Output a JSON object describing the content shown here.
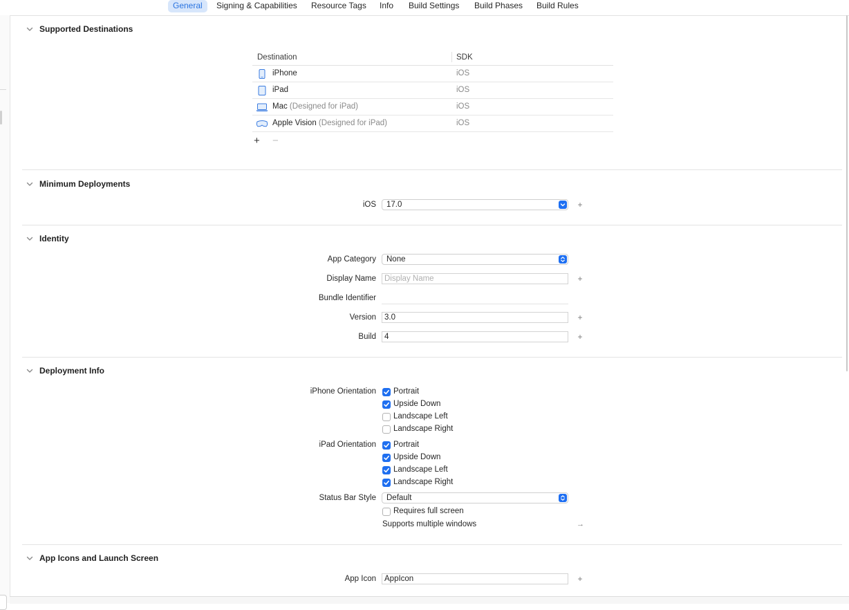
{
  "tabs": [
    {
      "label": "General",
      "active": true
    },
    {
      "label": "Signing & Capabilities"
    },
    {
      "label": "Resource Tags"
    },
    {
      "label": "Info"
    },
    {
      "label": "Build Settings"
    },
    {
      "label": "Build Phases"
    },
    {
      "label": "Build Rules"
    }
  ],
  "colors": {
    "accent": "#1f6ff0",
    "tab_active_bg": "#d7e6fb",
    "tab_active_text": "#2a74e0"
  },
  "supported_destinations": {
    "title": "Supported Destinations",
    "columns": [
      "Destination",
      "SDK"
    ],
    "rows": [
      {
        "icon": "iphone-icon",
        "name": "iPhone",
        "note": "",
        "sdk": "iOS"
      },
      {
        "icon": "ipad-icon",
        "name": "iPad",
        "note": "",
        "sdk": "iOS"
      },
      {
        "icon": "mac-laptop-icon",
        "name": "Mac",
        "note": " (Designed for iPad)",
        "sdk": "iOS"
      },
      {
        "icon": "vision-headset-icon",
        "name": "Apple Vision",
        "note": " (Designed for iPad)",
        "sdk": "iOS"
      }
    ],
    "add_label": "+",
    "remove_label": "−"
  },
  "minimum_deployments": {
    "title": "Minimum Deployments",
    "ios_label": "iOS",
    "ios_value": "17.0"
  },
  "identity": {
    "title": "Identity",
    "app_category_label": "App Category",
    "app_category_value": "None",
    "display_name_label": "Display Name",
    "display_name_placeholder": "Display Name",
    "bundle_identifier_label": "Bundle Identifier",
    "bundle_identifier_value": "",
    "version_label": "Version",
    "version_value": "3.0",
    "build_label": "Build",
    "build_value": "4"
  },
  "deployment_info": {
    "title": "Deployment Info",
    "iphone_orientation_label": "iPhone Orientation",
    "iphone_orientations": [
      {
        "label": "Portrait",
        "checked": true
      },
      {
        "label": "Upside Down",
        "checked": true
      },
      {
        "label": "Landscape Left",
        "checked": false
      },
      {
        "label": "Landscape Right",
        "checked": false
      }
    ],
    "ipad_orientation_label": "iPad Orientation",
    "ipad_orientations": [
      {
        "label": "Portrait",
        "checked": true
      },
      {
        "label": "Upside Down",
        "checked": true
      },
      {
        "label": "Landscape Left",
        "checked": true
      },
      {
        "label": "Landscape Right",
        "checked": true
      }
    ],
    "status_bar_style_label": "Status Bar Style",
    "status_bar_style_value": "Default",
    "requires_full_screen_label": "Requires full screen",
    "requires_full_screen_checked": false,
    "supports_multiple_windows_label": "Supports multiple windows",
    "arrow": "→"
  },
  "app_icons": {
    "title": "App Icons and Launch Screen",
    "app_icon_label": "App Icon",
    "app_icon_value": "AppIcon"
  },
  "plus": "+"
}
